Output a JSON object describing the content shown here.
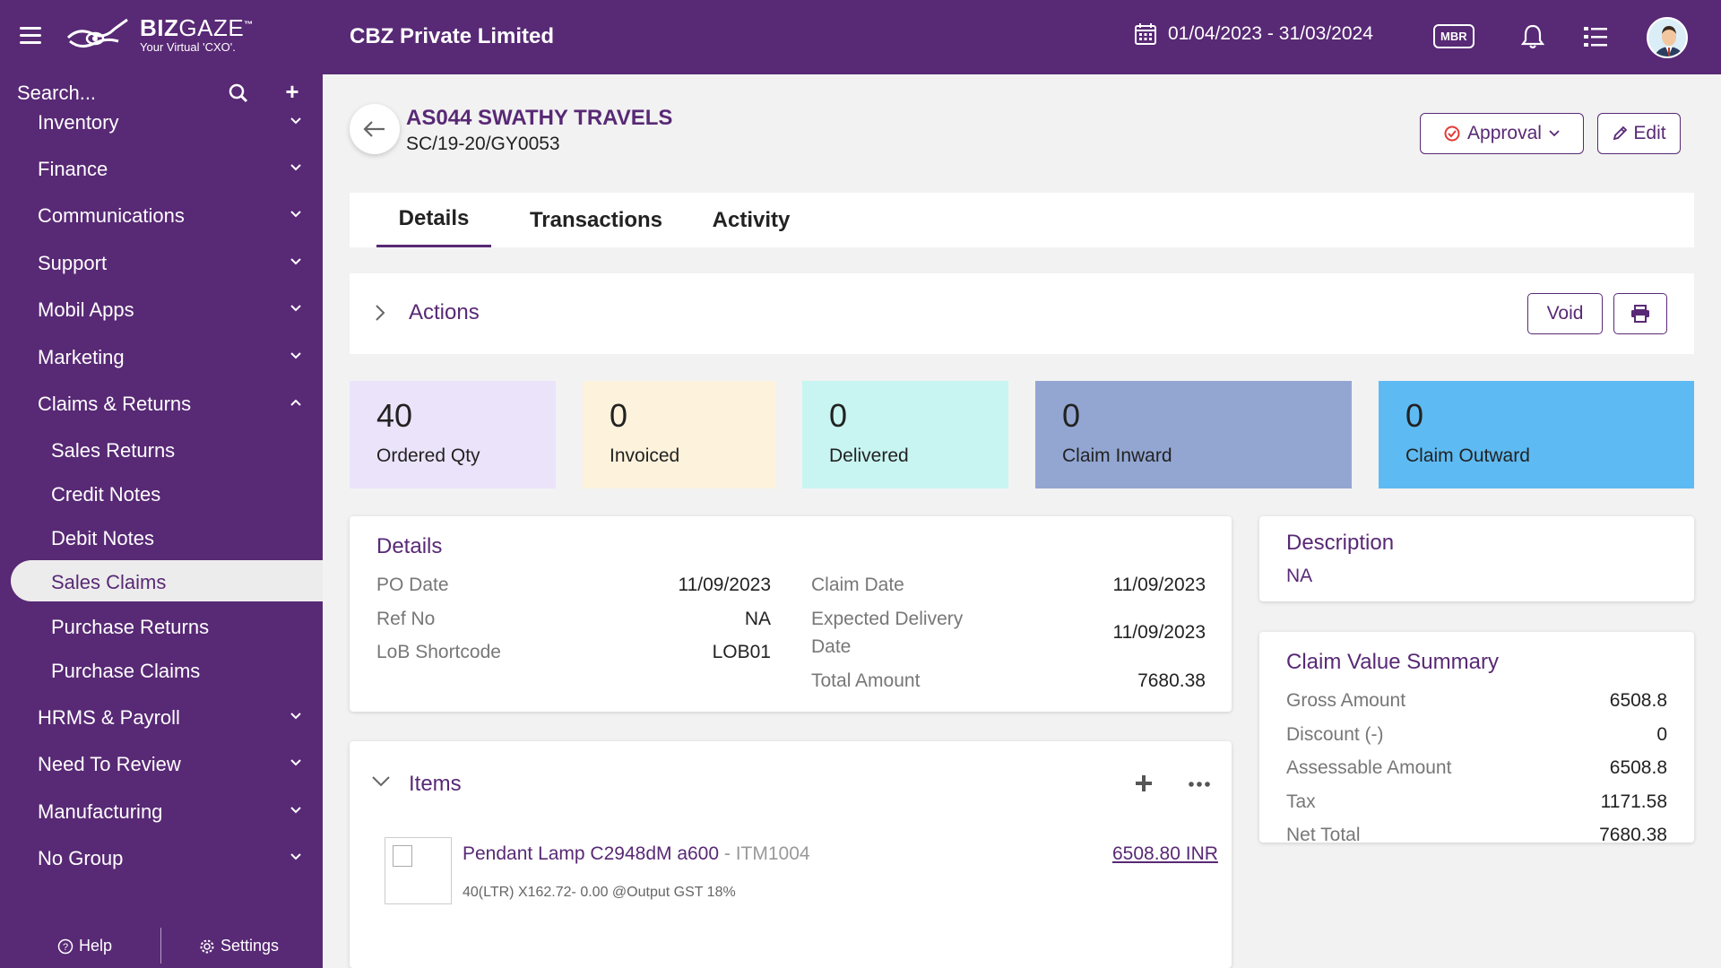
{
  "header": {
    "logo_name_bold": "BIZ",
    "logo_name_light": "GAZE",
    "logo_tm": "™",
    "logo_tagline": "Your Virtual 'CXO'.",
    "company": "CBZ Private Limited",
    "date_range": "01/04/2023 - 31/03/2024",
    "mbr_badge": "MBR"
  },
  "sidebar": {
    "search_placeholder": "Search...",
    "plus_label": "+",
    "items": [
      {
        "label": "Inventory"
      },
      {
        "label": "Finance"
      },
      {
        "label": "Communications"
      },
      {
        "label": "Support"
      },
      {
        "label": "Mobil Apps"
      },
      {
        "label": "Marketing"
      },
      {
        "label": "Claims & Returns"
      }
    ],
    "sub_items": [
      {
        "label": "Sales Returns"
      },
      {
        "label": "Credit Notes"
      },
      {
        "label": "Debit Notes"
      },
      {
        "label": "Sales Claims"
      },
      {
        "label": "Purchase Returns"
      },
      {
        "label": "Purchase Claims"
      }
    ],
    "items_after": [
      {
        "label": "HRMS & Payroll"
      },
      {
        "label": "Need To Review"
      },
      {
        "label": "Manufacturing"
      },
      {
        "label": "No Group"
      }
    ],
    "footer": {
      "help": "Help",
      "settings": "Settings"
    }
  },
  "record": {
    "title": "AS044 SWATHY TRAVELS",
    "code": "SC/19-20/GY0053",
    "approval_label": "Approval",
    "edit_label": "Edit"
  },
  "tabs": [
    {
      "label": "Details"
    },
    {
      "label": "Transactions"
    },
    {
      "label": "Activity"
    }
  ],
  "actions": {
    "label": "Actions",
    "void_label": "Void"
  },
  "stats": [
    {
      "value": "40",
      "label": "Ordered Qty",
      "color": "#ebe3fa"
    },
    {
      "value": "0",
      "label": "Invoiced",
      "color": "#fdf2dc"
    },
    {
      "value": "0",
      "label": "Delivered",
      "color": "#c8f5f1"
    },
    {
      "value": "0",
      "label": "Claim Inward",
      "color": "#93a6d2"
    },
    {
      "value": "0",
      "label": "Claim Outward",
      "color": "#5ebaf2"
    }
  ],
  "details": {
    "title": "Details",
    "left": [
      {
        "label": "PO Date",
        "value": "11/09/2023"
      },
      {
        "label": "Ref No",
        "value": "NA"
      },
      {
        "label": "LoB Shortcode",
        "value": "LOB01"
      }
    ],
    "right": {
      "claim_date_label": "Claim Date",
      "claim_date": "11/09/2023",
      "expected_delivery_label_1": "Expected Delivery",
      "expected_delivery_label_2": "Date",
      "expected_delivery": "11/09/2023",
      "total_amount_label": "Total Amount",
      "total_amount": "7680.38"
    }
  },
  "description": {
    "title": "Description",
    "value": "NA"
  },
  "summary": {
    "title": "Claim Value Summary",
    "rows": [
      {
        "label": "Gross Amount",
        "value": "6508.8"
      },
      {
        "label": "Discount (-)",
        "value": "0"
      },
      {
        "label": "Assessable Amount",
        "value": "6508.8"
      },
      {
        "label": "Tax",
        "value": "1171.58"
      },
      {
        "label": "Net Total",
        "value": "7680.38"
      }
    ]
  },
  "items": {
    "title": "Items",
    "list": [
      {
        "name": "Pendant Lamp C2948dM a600",
        "code": " - ITM1004",
        "meta": "40(LTR) X162.72- 0.00 @Output GST 18%",
        "amount": "6508.80 INR"
      }
    ]
  }
}
